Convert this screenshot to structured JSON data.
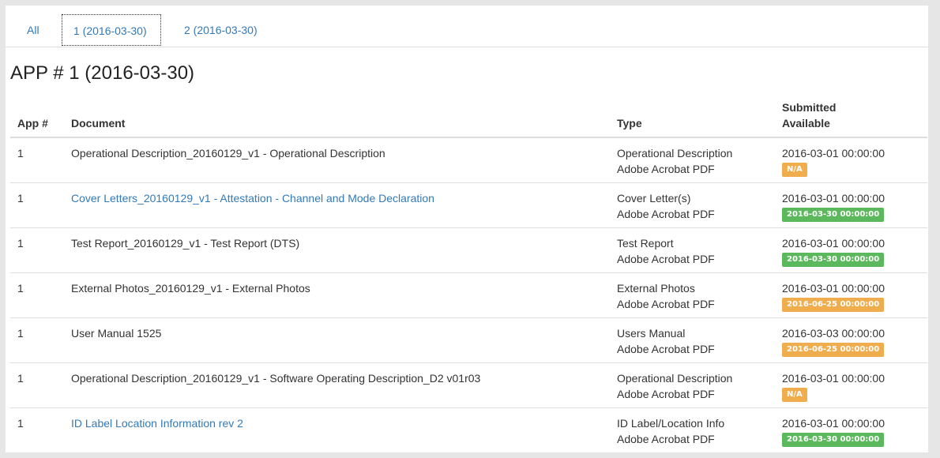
{
  "tabs": [
    {
      "label": "All"
    },
    {
      "label": "1 (2016-03-30)"
    },
    {
      "label": "2 (2016-03-30)"
    }
  ],
  "page_title": "APP # 1 (2016-03-30)",
  "table": {
    "headers": {
      "app": "App #",
      "document": "Document",
      "type": "Type",
      "submitted": "Submitted",
      "available": "Available"
    },
    "rows": [
      {
        "app": "1",
        "document": "Operational Description_20160129_v1 - Operational Description",
        "type": "Operational Description",
        "format": "Adobe Acrobat PDF",
        "submitted": "2016-03-01 00:00:00",
        "available": "N/A",
        "status_color": "#f0ad4e"
      },
      {
        "app": "1",
        "document": "Cover Letters_20160129_v1 - Attestation - Channel and Mode Declaration",
        "type": "Cover Letter(s)",
        "format": "Adobe Acrobat PDF",
        "submitted": "2016-03-01 00:00:00",
        "available": "2016-03-30 00:00:00",
        "status_color": "#5cb85c"
      },
      {
        "app": "1",
        "document": "Test Report_20160129_v1 - Test Report (DTS)",
        "type": "Test Report",
        "format": "Adobe Acrobat PDF",
        "submitted": "2016-03-01 00:00:00",
        "available": "2016-03-30 00:00:00",
        "status_color": "#5cb85c"
      },
      {
        "app": "1",
        "document": "External Photos_20160129_v1 - External Photos",
        "type": "External Photos",
        "format": "Adobe Acrobat PDF",
        "submitted": "2016-03-01 00:00:00",
        "available": "2016-06-25 00:00:00",
        "status_color": "#f0ad4e"
      },
      {
        "app": "1",
        "document": "User Manual 1525",
        "type": "Users Manual",
        "format": "Adobe Acrobat PDF",
        "submitted": "2016-03-03 00:00:00",
        "available": "2016-06-25 00:00:00",
        "status_color": "#f0ad4e"
      },
      {
        "app": "1",
        "document": "Operational Description_20160129_v1 - Software Operating Description_D2 v01r03",
        "type": "Operational Description",
        "format": "Adobe Acrobat PDF",
        "submitted": "2016-03-01 00:00:00",
        "available": "N/A",
        "status_color": "#f0ad4e"
      },
      {
        "app": "1",
        "document": "ID Label Location Information rev 2",
        "type": "ID Label/Location Info",
        "format": "Adobe Acrobat PDF",
        "submitted": "2016-03-01 00:00:00",
        "available": "2016-03-30 00:00:00",
        "status_color": "#5cb85c"
      }
    ]
  },
  "colors": {
    "link": "#337ab7",
    "badge_orange": "#f0ad4e",
    "badge_green": "#5cb85c"
  }
}
